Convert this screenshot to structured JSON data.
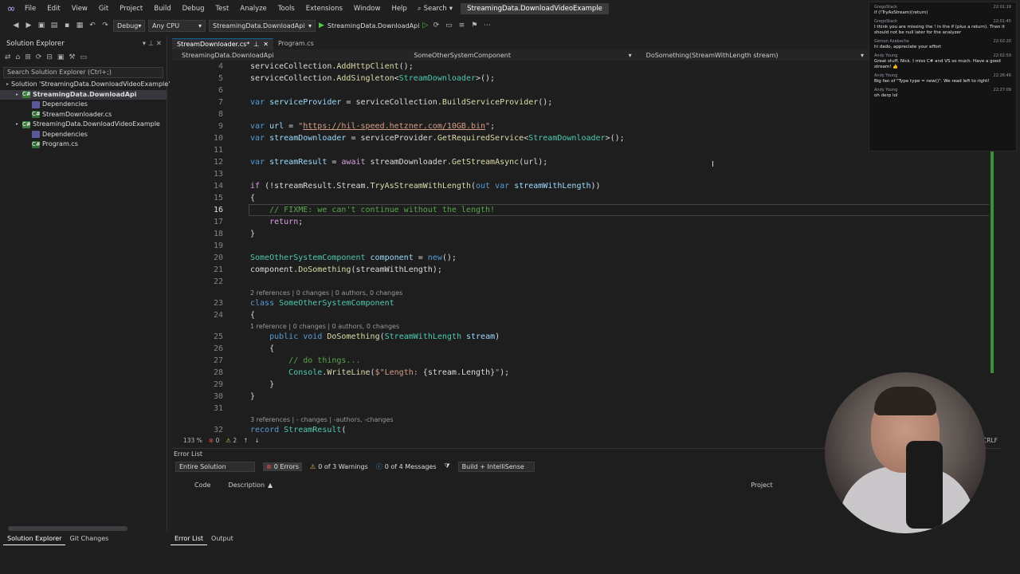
{
  "menu": {
    "items": [
      "File",
      "Edit",
      "View",
      "Git",
      "Project",
      "Build",
      "Debug",
      "Test",
      "Analyze",
      "Tools",
      "Extensions",
      "Window",
      "Help"
    ],
    "search_label": "Search",
    "solution_title": "StreamingData.DownloadVideoExample"
  },
  "toolbar": {
    "config": "Debug",
    "platform": "Any CPU",
    "startup_project": "StreamingData.DownloadApi",
    "run_target": "StreamingData.DownloadApi"
  },
  "solution_explorer": {
    "title": "Solution Explorer",
    "search_placeholder": "Search Solution Explorer (Ctrl+;)",
    "items": [
      {
        "label": "Solution 'StreamingData.DownloadVideoExample' (",
        "indent": 0,
        "icon": "solution-icon"
      },
      {
        "label": "StreamingData.DownloadApi",
        "indent": 1,
        "icon": "csharp-project-icon",
        "bold": true,
        "selected": true
      },
      {
        "label": "Dependencies",
        "indent": 2,
        "icon": "dependencies-icon"
      },
      {
        "label": "StreamDownloader.cs",
        "indent": 2,
        "icon": "csharp-file-icon"
      },
      {
        "label": "StreamingData.DownloadVideoExample",
        "indent": 1,
        "icon": "csharp-project-icon"
      },
      {
        "label": "Dependencies",
        "indent": 2,
        "icon": "dependencies-icon"
      },
      {
        "label": "Program.cs",
        "indent": 2,
        "icon": "csharp-file-icon"
      }
    ]
  },
  "tabs": [
    {
      "label": "StreamDownloader.cs*",
      "active": true
    },
    {
      "label": "Program.cs",
      "active": false
    }
  ],
  "navbar": {
    "project": "StreamingData.DownloadApi",
    "type": "SomeOtherSystemComponent",
    "member": "DoSomething(StreamWithLength stream)"
  },
  "code": {
    "current_line": "16",
    "lines": [
      {
        "n": "4",
        "html": "serviceCollection.<span class='fn'>AddHttpClient</span>();"
      },
      {
        "n": "5",
        "html": "serviceCollection.<span class='fn'>AddSingleton</span>&lt;<span class='typ'>StreamDownloader</span>&gt;();"
      },
      {
        "n": "6",
        "html": ""
      },
      {
        "n": "7",
        "html": "<span class='kw'>var</span> <span class='var'>serviceProvider</span> = serviceCollection.<span class='fn'>BuildServiceProvider</span>();"
      },
      {
        "n": "8",
        "html": ""
      },
      {
        "n": "9",
        "html": "<span class='kw'>var</span> <span class='var'>url</span> = <span class='str'>\"</span><span class='url'>https://hil-speed.hetzner.com/10GB.bin</span><span class='str'>\"</span>;"
      },
      {
        "n": "10",
        "html": "<span class='kw'>var</span> <span class='var'>streamDownloader</span> = serviceProvider.<span class='fn'>GetRequiredService</span>&lt;<span class='typ'>StreamDownloader</span>&gt;();"
      },
      {
        "n": "11",
        "html": ""
      },
      {
        "n": "12",
        "html": "<span class='kw'>var</span> <span class='var'>streamResult</span> = <span class='ctl'>await</span> streamDownloader.<span class='fn'>GetStreamAsync</span>(url);"
      },
      {
        "n": "13",
        "html": ""
      },
      {
        "n": "14",
        "html": "<span class='ctl'>if</span> (!streamResult.Stream.<span class='fn'>TryAsStreamWithLength</span>(<span class='kw'>out</span> <span class='kw'>var</span> <span class='var'>streamWithLength</span>))"
      },
      {
        "n": "15",
        "html": "{"
      },
      {
        "n": "16",
        "html": "    <span class='cmt'>// FIXME: we can't continue without the length!</span>"
      },
      {
        "n": "17",
        "html": "    <span class='ctl'>return</span>;"
      },
      {
        "n": "18",
        "html": "}"
      },
      {
        "n": "19",
        "html": ""
      },
      {
        "n": "20",
        "html": "<span class='typ'>SomeOtherSystemComponent</span> <span class='var'>component</span> = <span class='kw'>new</span>();"
      },
      {
        "n": "21",
        "html": "component.<span class='fn'>DoSomething</span>(streamWithLength);"
      },
      {
        "n": "22",
        "html": ""
      },
      {
        "n": "23",
        "html": "<span class='kw'>class</span> <span class='typ'>SomeOtherSystemComponent</span>",
        "lens": "2 references | 0 changes | 0 authors, 0 changes"
      },
      {
        "n": "24",
        "html": "{"
      },
      {
        "n": "25",
        "html": "    <span class='kw'>public</span> <span class='kw'>void</span> <span class='fn'>DoSomething</span>(<span class='typ'>StreamWithLength</span> <span class='var'>stream</span>)",
        "lens": "1 reference | 0 changes | 0 authors, 0 changes"
      },
      {
        "n": "26",
        "html": "    {"
      },
      {
        "n": "27",
        "html": "        <span class='cmt'>// do things...</span>"
      },
      {
        "n": "28",
        "html": "        <span class='typ'>Console</span>.<span class='fn'>WriteLine</span>(<span class='str'>$\"Length: </span>{stream.Length}<span class='str'>\"</span>);"
      },
      {
        "n": "29",
        "html": "    }"
      },
      {
        "n": "30",
        "html": "}"
      },
      {
        "n": "31",
        "html": ""
      },
      {
        "n": "32",
        "html": "<span class='kw'>record</span> <span class='typ'>StreamResult</span>(",
        "lens": "3 references | - changes | -authors, -changes"
      }
    ]
  },
  "status": {
    "zoom": "133 %",
    "errors": "0",
    "warnings": "2",
    "line_ending": "CRLF"
  },
  "error_list": {
    "title": "Error List",
    "scope": "Entire Solution",
    "errors": "0 Errors",
    "warnings": "0 of 3 Warnings",
    "messages": "0 of 4 Messages",
    "filter": "Build + IntelliSense",
    "col_code": "Code",
    "col_description": "Description",
    "col_project": "Project"
  },
  "bottom_tabs_left": [
    "Solution Explorer",
    "Git Changes"
  ],
  "bottom_tabs_right": [
    "Error List",
    "Output"
  ],
  "chat": [
    {
      "user": "GregoStack",
      "time": "22:01:19",
      "text": "if (!TryAsStream)(return)"
    },
    {
      "user": "GregoStack",
      "time": "22:01:45",
      "text": "I think you are missing the ! in the if (plus a return). Then it should not be null later for the analyzer"
    },
    {
      "user": "Gerson Azabache",
      "time": "22:02:20",
      "text": "hi dado, appreciate your effort"
    },
    {
      "user": "Andy Young",
      "time": "22:02:59",
      "text": "Great stuff, Nick. I miss C# and VS so much. Have a good stream! 👍"
    },
    {
      "user": "Andy Young",
      "time": "22:26:46",
      "text": "Big fan of \"Type type = new()\". We read left to right!"
    },
    {
      "user": "Andy Young",
      "time": "22:27:09",
      "text": "oh derp lol"
    }
  ]
}
